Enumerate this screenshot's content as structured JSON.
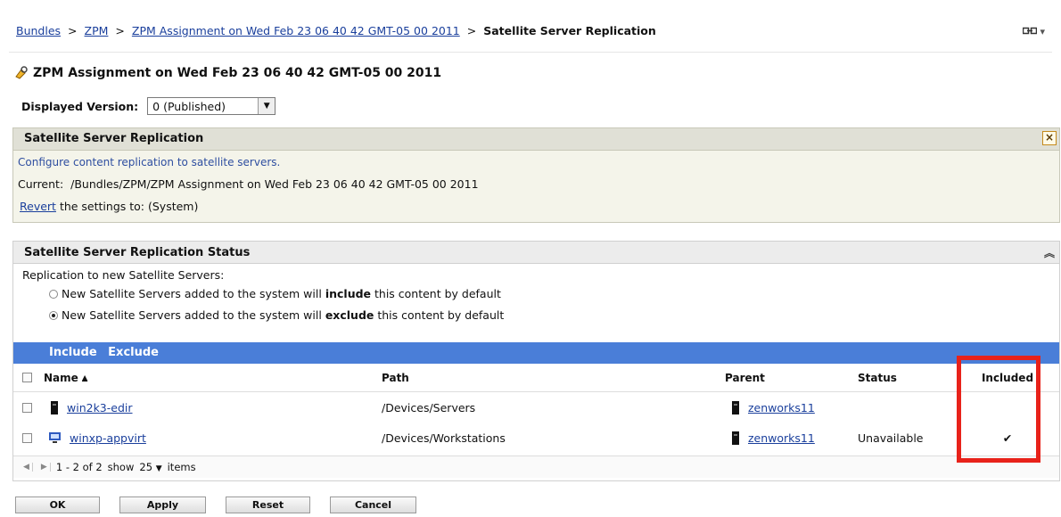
{
  "breadcrumb": {
    "items": [
      "Bundles",
      "ZPM",
      "ZPM Assignment on Wed Feb 23 06 40 42 GMT-05 00 2011"
    ],
    "current": "Satellite Server Replication",
    "separator": ">"
  },
  "header_tools": {
    "icon": "link-icon",
    "menu": "▾"
  },
  "page": {
    "title": "ZPM Assignment on Wed Feb 23 06 40 42 GMT-05 00 2011",
    "version_label": "Displayed Version:",
    "version_value": "0 (Published)"
  },
  "settings_panel": {
    "title": "Satellite Server Replication",
    "description": "Configure content replication to satellite servers.",
    "current_label": "Current:",
    "current_path": "/Bundles/ZPM/ZPM Assignment on Wed Feb 23 06 40 42 GMT-05 00 2011",
    "revert_link": "Revert",
    "revert_text": "the settings to: (System)",
    "close": "×"
  },
  "status_panel": {
    "title": "Satellite Server Replication Status",
    "collapse": "»",
    "replication_label": "Replication to new Satellite Servers:",
    "option_include": {
      "pre": "New Satellite Servers added to the system will ",
      "bold": "include",
      "post": " this content by default",
      "selected": false
    },
    "option_exclude": {
      "pre": "New Satellite Servers added to the system will ",
      "bold": "exclude",
      "post": " this content by default",
      "selected": true
    },
    "actions": {
      "include": "Include",
      "exclude": "Exclude"
    },
    "columns": {
      "name": "Name",
      "sort_indicator": "▲",
      "path": "Path",
      "parent": "Parent",
      "status": "Status",
      "included": "Included"
    },
    "rows": [
      {
        "name": "win2k3-edir",
        "path": "/Devices/Servers",
        "parent": "zenworks11",
        "status": "",
        "included": "",
        "icon": "server-icon"
      },
      {
        "name": "winxp-appvirt",
        "path": "/Devices/Workstations",
        "parent": "zenworks11",
        "status": "Unavailable",
        "included": "✔",
        "icon": "workstation-icon"
      }
    ],
    "pager": {
      "range": "1 - 2 of 2",
      "show_label": "show",
      "page_size": "25",
      "items_label": "items"
    }
  },
  "footer": {
    "ok": "OK",
    "apply": "Apply",
    "reset": "Reset",
    "cancel": "Cancel"
  },
  "colors": {
    "action_bar": "#4a7ed8",
    "link": "#1a3f9c",
    "highlight": "#e8221a"
  }
}
